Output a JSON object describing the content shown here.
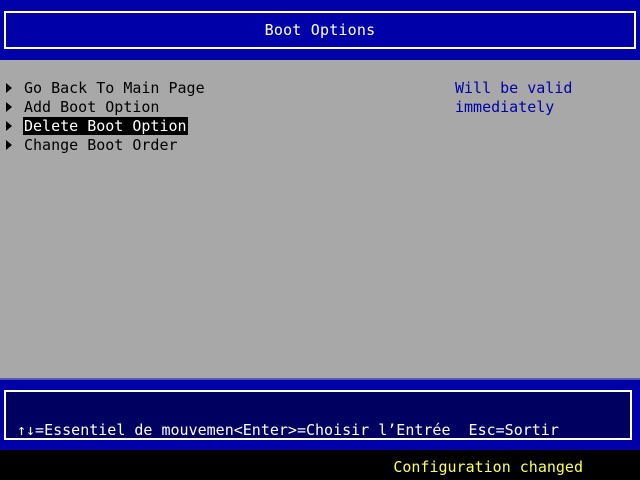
{
  "header": {
    "title": "Boot Options"
  },
  "menu": {
    "items": [
      {
        "label": "Go Back To Main Page",
        "selected": false,
        "icon": "right-triangle-icon"
      },
      {
        "label": "Add Boot Option",
        "selected": false,
        "icon": "right-triangle-icon"
      },
      {
        "label": "Delete Boot Option",
        "selected": true,
        "icon": "right-triangle-icon"
      },
      {
        "label": "Change Boot Order",
        "selected": false,
        "icon": "right-triangle-icon"
      }
    ]
  },
  "help": {
    "text": "Will be valid\nimmediately"
  },
  "footer": {
    "hint": "↑↓=Essentiel de mouvemen<Enter>=Choisir l’Entrée  Esc=Sortir"
  },
  "status": {
    "text": "Configuration changed"
  },
  "colors": {
    "background": "#000000",
    "header_bg": "#0000a8",
    "main_bg": "#a8a8a8",
    "selected_bg": "#000000",
    "selected_fg": "#ffffff",
    "help_fg": "#0000a8",
    "status_fg": "#ffff55"
  }
}
